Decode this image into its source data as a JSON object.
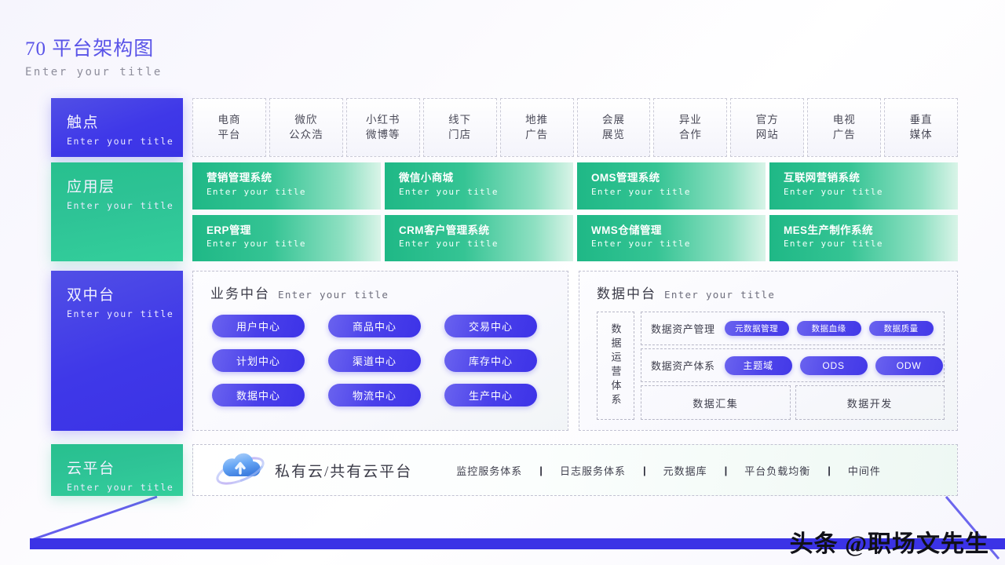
{
  "header": {
    "title": "70 平台架构图",
    "subtitle": "Enter your title"
  },
  "layers": [
    {
      "name": "触点",
      "sub": "Enter your title",
      "color": "#413ae7"
    },
    {
      "name": "应用层",
      "sub": "Enter your title",
      "color": "#2ec396"
    },
    {
      "name": "双中台",
      "sub": "Enter your title",
      "color": "#413ae7"
    },
    {
      "name": "云平台",
      "sub": "Enter your title",
      "color": "#2ec396"
    }
  ],
  "touchpoints": [
    {
      "line1": "电商",
      "line2": "平台"
    },
    {
      "line1": "微欣",
      "line2": "公众浩"
    },
    {
      "line1": "小红书",
      "line2": "微博等"
    },
    {
      "line1": "线下",
      "line2": "门店"
    },
    {
      "line1": "地推",
      "line2": "广告"
    },
    {
      "line1": "会展",
      "line2": "展览"
    },
    {
      "line1": "异业",
      "line2": "合作"
    },
    {
      "line1": "官方",
      "line2": "网站"
    },
    {
      "line1": "电视",
      "line2": "广告"
    },
    {
      "line1": "垂直",
      "line2": "媒体"
    }
  ],
  "applications": [
    {
      "title": "营销管理系统",
      "sub": "Enter your title"
    },
    {
      "title": "微信小商城",
      "sub": "Enter your title"
    },
    {
      "title": "OMS管理系统",
      "sub": "Enter your title"
    },
    {
      "title": "互联网营销系统",
      "sub": "Enter your title"
    },
    {
      "title": "ERP管理",
      "sub": "Enter your title"
    },
    {
      "title": "CRM客户管理系统",
      "sub": "Enter your title"
    },
    {
      "title": "WMS仓储管理",
      "sub": "Enter your title"
    },
    {
      "title": "MES生产制作系统",
      "sub": "Enter your title"
    }
  ],
  "business_platform": {
    "title": "业务中台",
    "subtitle": "Enter your title",
    "centers": [
      "用户中心",
      "商品中心",
      "交易中心",
      "计划中心",
      "渠道中心",
      "库存中心",
      "数据中心",
      "物流中心",
      "生产中心"
    ]
  },
  "data_platform": {
    "title": "数据中台",
    "subtitle": "Enter your title",
    "ops_label": "数据运营体系",
    "rows": [
      {
        "label": "数据资产管理",
        "badges": [
          "元数据管理",
          "数据血缘",
          "数据质量"
        ]
      },
      {
        "label": "数据资产体系",
        "badges": [
          "主题域",
          "ODS",
          "ODW"
        ]
      }
    ],
    "bottom": [
      "数据汇集",
      "数据开发"
    ]
  },
  "cloud": {
    "icon": "cloud-upload-icon",
    "title": "私有云/共有云平台",
    "services": [
      "监控服务体系",
      "日志服务体系",
      "元数据库",
      "平台负载均衡",
      "中间件"
    ],
    "separator": "|"
  },
  "watermark": "头条 @职场文先生",
  "theme": {
    "primary_blue": "#413ae7",
    "primary_green": "#2ec396",
    "title_purple": "#5a54e8",
    "dash_border": "#c2c2d2",
    "background": "#f8f7fd"
  }
}
